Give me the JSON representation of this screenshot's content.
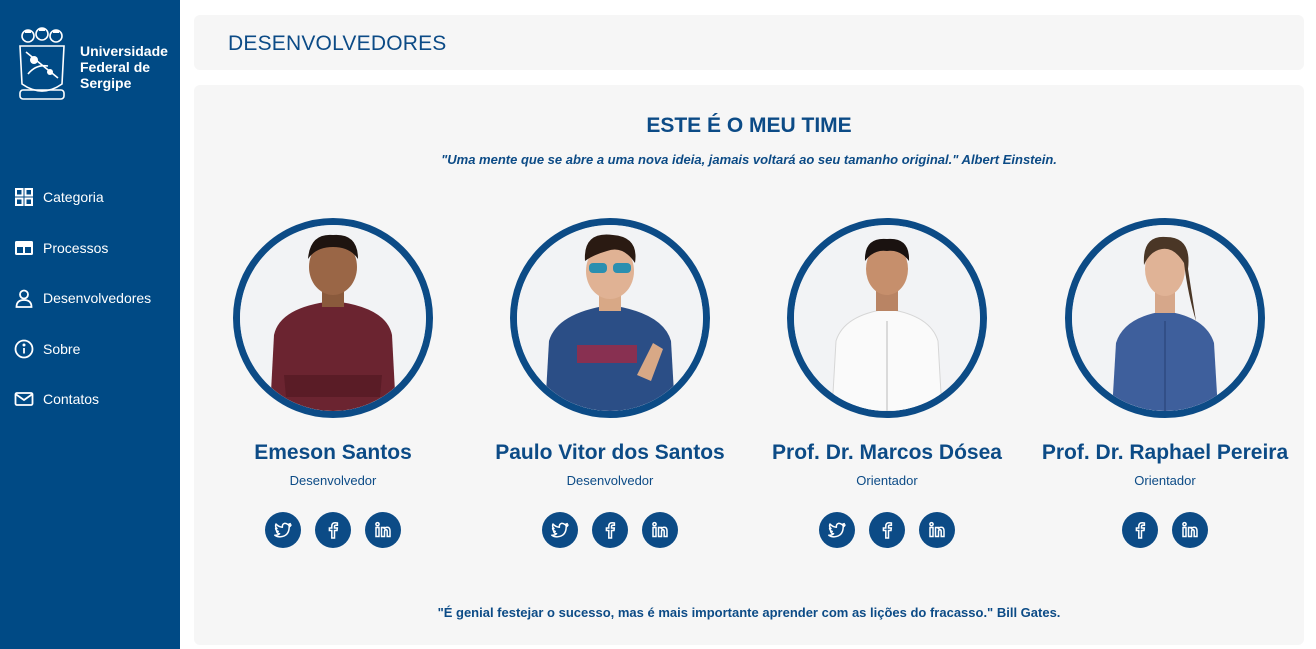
{
  "sidebar": {
    "logo": {
      "line1": "Universidade",
      "line2": "Federal de",
      "line3": "Sergipe"
    },
    "items": [
      {
        "label": "Categoria",
        "icon": "grid-icon"
      },
      {
        "label": "Processos",
        "icon": "table-icon"
      },
      {
        "label": "Desenvolvedores",
        "icon": "user-icon"
      },
      {
        "label": "Sobre",
        "icon": "info-icon"
      },
      {
        "label": "Contatos",
        "icon": "mail-icon"
      }
    ]
  },
  "header": {
    "title": "DESENVOLVEDORES"
  },
  "main": {
    "title": "ESTE É O MEU TIME",
    "quote_top": "\"Uma mente que se abre a uma nova ideia, jamais voltará ao seu tamanho original.\" Albert Einstein.",
    "quote_bottom": "\"É genial festejar o sucesso, mas é mais importante aprender com as lições do fracasso.\" Bill Gates.",
    "members": [
      {
        "name": "Emeson Santos",
        "role": "Desenvolvedor",
        "socials": [
          "twitter",
          "facebook",
          "linkedin"
        ]
      },
      {
        "name": "Paulo Vitor dos Santos",
        "role": "Desenvolvedor",
        "socials": [
          "twitter",
          "facebook",
          "linkedin"
        ]
      },
      {
        "name": "Prof. Dr. Marcos Dósea",
        "role": "Orientador",
        "socials": [
          "twitter",
          "facebook",
          "linkedin"
        ]
      },
      {
        "name": "Prof. Dr. Raphael Pereira",
        "role": "Orientador",
        "socials": [
          "facebook",
          "linkedin"
        ]
      }
    ]
  },
  "colors": {
    "sidebar_bg": "#004a85",
    "primary": "#0c4b86",
    "panel_bg": "#f6f6f6"
  }
}
